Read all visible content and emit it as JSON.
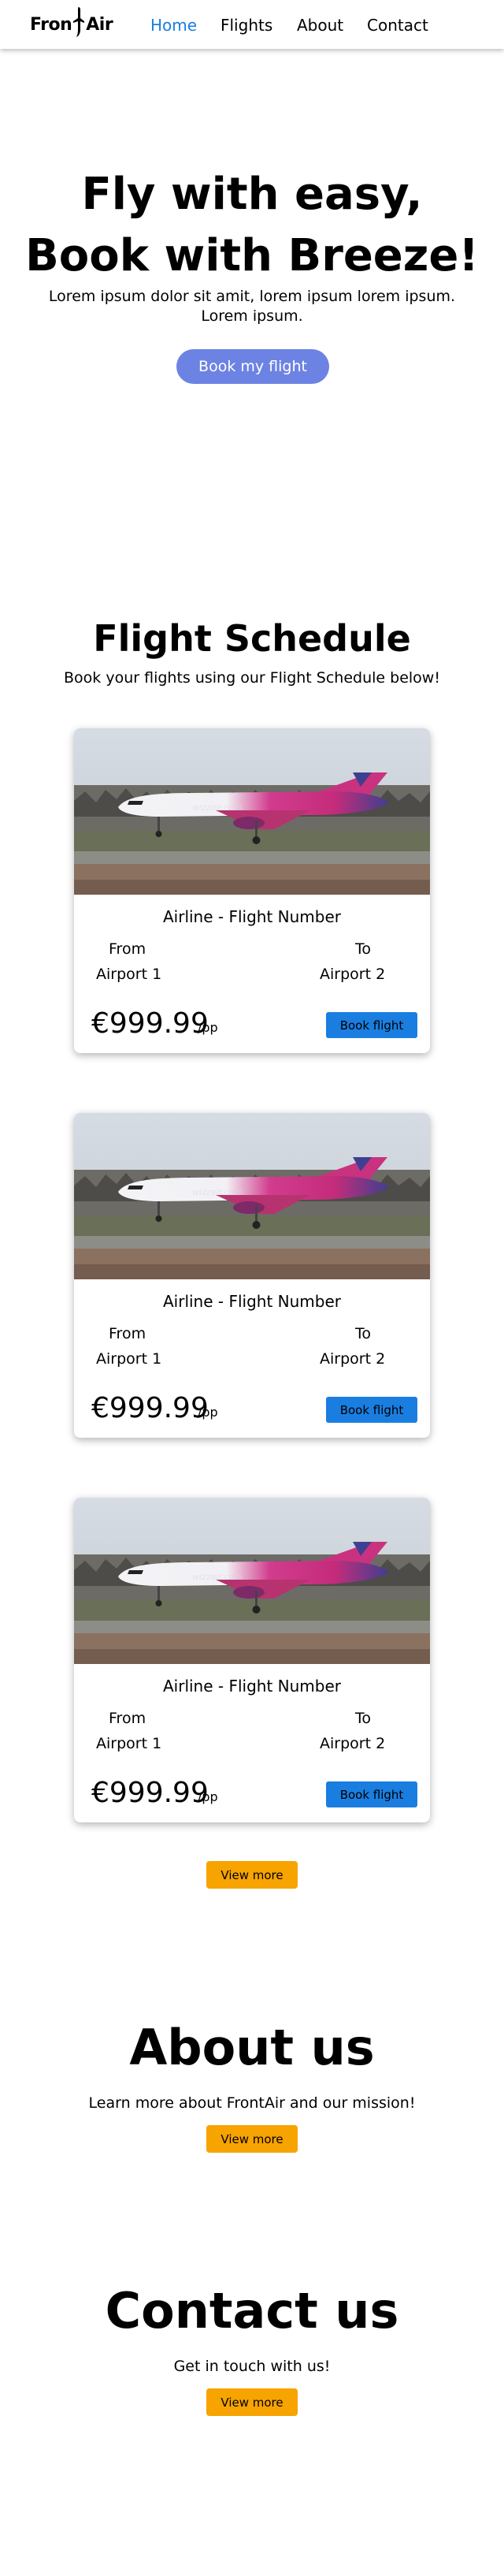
{
  "nav": {
    "logo_before": "Fron",
    "logo_after": "Air",
    "links": [
      "Home",
      "Flights",
      "About",
      "Contact"
    ],
    "active_color": "#1a7ee0"
  },
  "hero": {
    "title_line1": "Fly with easy,",
    "title_line2": "Book with Breeze!",
    "subtitle": "Lorem ipsum dolor sit amit, lorem ipsum lorem ipsum. Lorem ipsum.",
    "button": "Book my flight",
    "button_color": "#6c83e3"
  },
  "schedule": {
    "title": "Flight Schedule",
    "subtitle": "Book your flights using our Flight Schedule below!",
    "flights": [
      {
        "heading": "Airline - Flight Number",
        "from_label": "From",
        "from": "Airport 1",
        "to_label": "To",
        "to": "Airport 2",
        "price": "€999.99",
        "unit": "/pp",
        "button": "Book flight",
        "image": "airplane-photo"
      },
      {
        "heading": "Airline - Flight Number",
        "from_label": "From",
        "from": "Airport 1",
        "to_label": "To",
        "to": "Airport 2",
        "price": "€999.99",
        "unit": "/pp",
        "button": "Book flight",
        "image": "airplane-photo"
      },
      {
        "heading": "Airline - Flight Number",
        "from_label": "From",
        "from": "Airport 1",
        "to_label": "To",
        "to": "Airport 2",
        "price": "€999.99",
        "unit": "/pp",
        "button": "Book flight",
        "image": "airplane-photo"
      }
    ],
    "view_more": "View more"
  },
  "about": {
    "title": "About us",
    "subtitle": "Learn more about FrontAir and our mission!",
    "button": "View more"
  },
  "contact": {
    "title": "Contact us",
    "subtitle": "Get in touch with us!",
    "button": "View more"
  },
  "colors": {
    "book_flight_button": "#1a7ee0",
    "view_more_button": "#f7a300"
  }
}
